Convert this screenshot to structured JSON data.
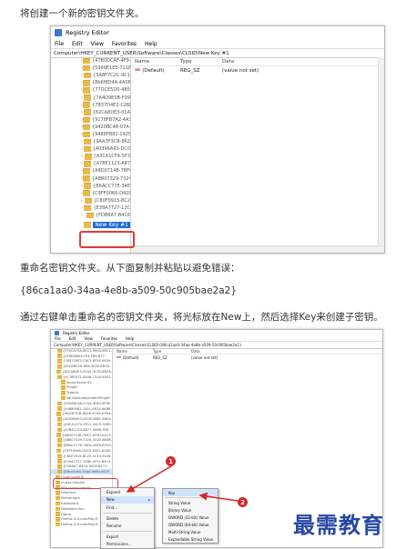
{
  "instructions": {
    "p1": "将创建一个新的密钥文件夹。",
    "p2": "重命名密钥文件夹。从下面复制并粘贴以避免错误：",
    "p3": "{86ca1aa0-34aa-4e8b-a509-50c905bae2a2}",
    "p4": "通过右键单击重命名的密钥文件夹，将光标放在New上，然后选择Key来创建子密钥。"
  },
  "window1": {
    "title": "Registry Editor",
    "menu": [
      "File",
      "Edit",
      "View",
      "Favorites",
      "Help"
    ],
    "address": "Computer\\HKEY_CURRENT_USER\\Software\\Classes\\CLSID\\New Key #1",
    "tree": [
      "{47B0DCAF-4F9-",
      "{5999E1EE-711E",
      "{5A8F7C2C-9C1",
      "{8b6f8D4A-4A0E",
      "{77DCE5D0-4B5",
      "{7A4D9E0B-F09",
      "{7B37D4E2-C26F",
      "{82CA8DE3-01A",
      "{9178FB7A2-4A3",
      "{9420BC48-07A-",
      "{9488FB82-1925",
      "{9AA3F3CB-862",
      "{A0396A93-DC0",
      "{A3CA1CF4-5F3",
      "{A7BE1123-A87",
      "{A8D0714B-7BF6",
      "{AB807329-7324",
      "{B6ACC77E-34E",
      "{C9FF0066-D42D",
      "{C80F0915-BC2",
      "{E39A7727-12C",
      "{FDB6A7-B4C6"
    ],
    "new_key": "New Key #1",
    "columns": {
      "name": "Name",
      "type": "Type",
      "data": "Data"
    },
    "value_row": {
      "name": "(Default)",
      "type": "REG_SZ",
      "data": "(value not set)"
    }
  },
  "window2": {
    "tree": [
      "{7F0CA75A-8EC1-985A-85C1-",
      "{3F8DDB0A-FE4-FB4-B77-",
      "{7B37C8E2-C6CF-8F4E-9639-",
      "{4ECB6E3D-6E8-4E3E-8B78-",
      "{82CA8DE3-01A3-4C3E-8B7A-",
      "{9178FB72-A4A8-731A-9AE3-",
      "InprocServer32",
      "ProgID",
      "TypeLib",
      "VersionIndependentProgID",
      "{9420BC48-07A4-4F89-9E9E-",
      "{9488FB82-1921-4B74-A8BB-",
      "{9AA3F3CB-8628-4C9A-A9D4-",
      "{A0396A93-DC06-4BEF-B9E4-",
      "{A3CA1CF4-5F12-4AC3-9180-",
      "{A7BE1123-A877-4988-9E8-",
      "{A8D0714B-7BFC-4F0D-A1C9-",
      "{AB807329-7324-431B-8B3B-",
      "{B6ACC77E-34EA-48F6-B7A3-",
      "{C9FF0066-D42D-4001-A2D0-",
      "{C80F0915-BC25-4C14-9106-",
      "{E39A7727-12BE-4F91-B9C4-",
      "{FDB6A7-B4C6-4000-B271-"
    ],
    "selected_key": "{86ca1aa0-34aa-4e8b-a509",
    "lower_tree": [
      "ComInvokeHS",
      "cs.exe.rshpafrl",
      "d8v.county.haprojl",
      "Directory",
      "Elementgcs",
      "Extensions",
      "Feedback-Hun",
      "Figma",
      "FireFox.Crrl.AutoPlay.H",
      "FireFox.Crrl.AutoPlay.H"
    ],
    "columns": {
      "name": "Name",
      "type": "Type",
      "data": "Data"
    },
    "value_row": {
      "name": "(Default)",
      "type": "REG_SZ",
      "data": "(value not set)"
    },
    "context_menu": [
      {
        "label": "Expand"
      },
      {
        "label": "New",
        "arrow": "▸",
        "highlight": true
      },
      {
        "label": "Find..."
      },
      {
        "separator": true
      },
      {
        "label": "Delete"
      },
      {
        "label": "Rename"
      },
      {
        "separator": true
      },
      {
        "label": "Export"
      },
      {
        "label": "Permissions..."
      }
    ],
    "submenu": [
      "Key",
      "",
      "String Value",
      "Binary Value",
      "DWORD (32-bit) Value",
      "QWORD (64-bit) Value",
      "Multi-String Value",
      "Expandable String Value"
    ]
  },
  "badges": [
    "1",
    "2"
  ],
  "watermark": "最需教育",
  "colors": {
    "highlight_red": "#e53935",
    "badge_red": "#d62828",
    "selection_blue": "#1e6ad6",
    "folder_yellow": "#e9b949",
    "watermark_blue": "#2747a5"
  }
}
